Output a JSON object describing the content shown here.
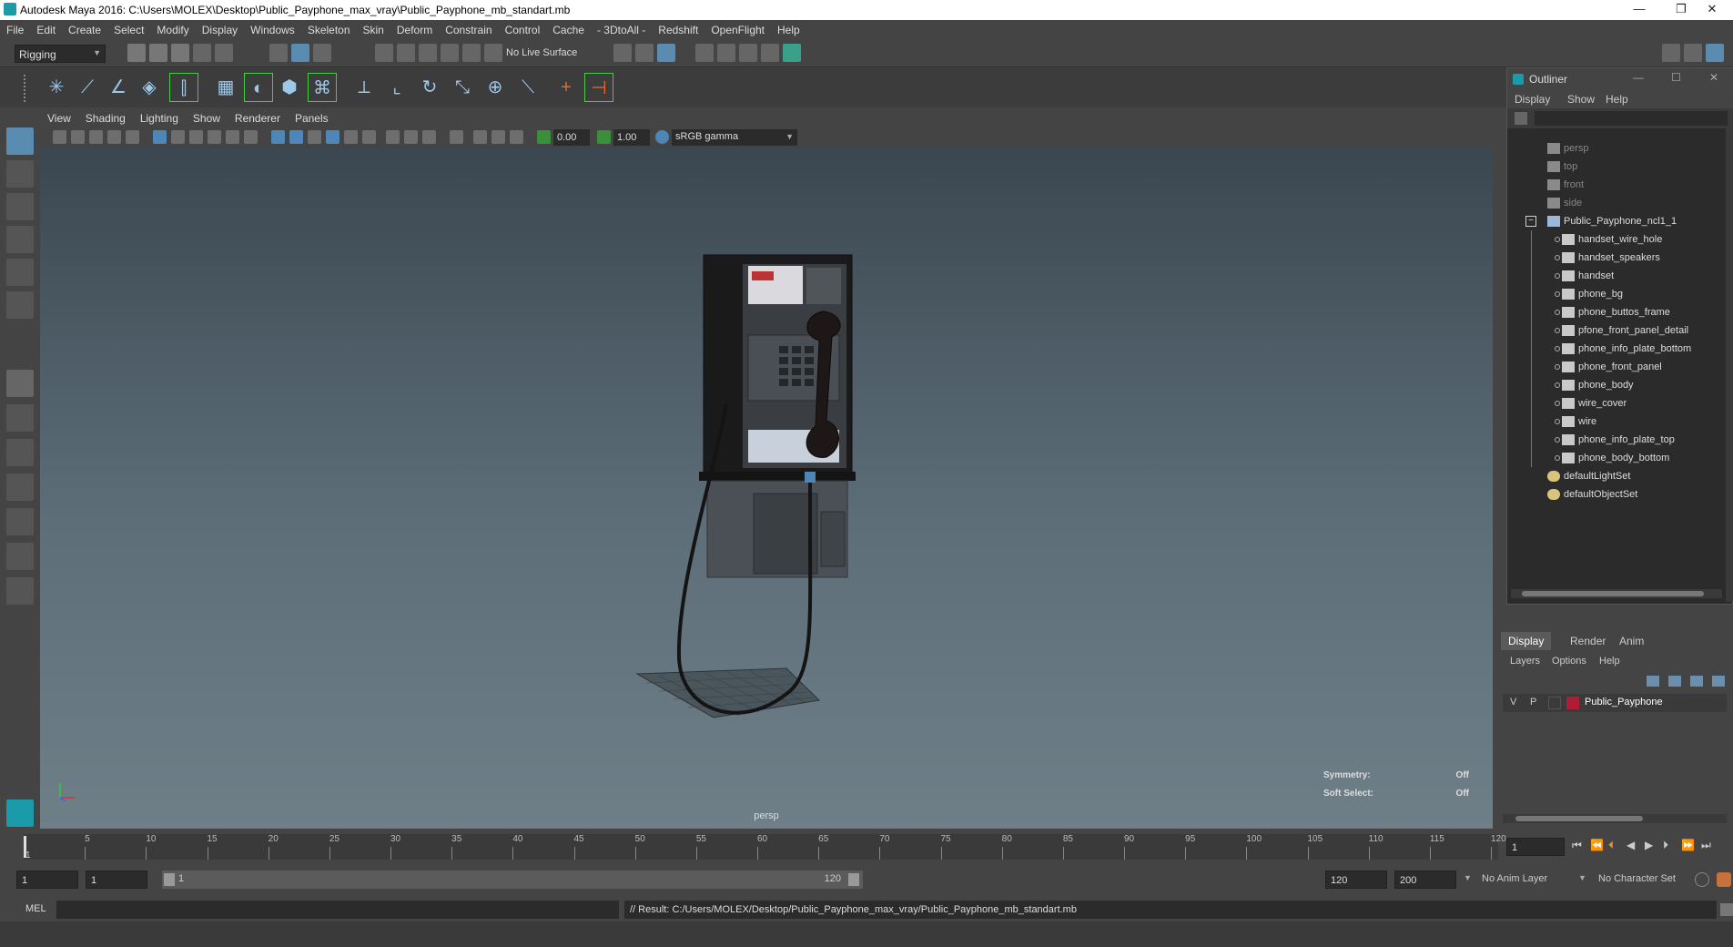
{
  "window": {
    "title": "Autodesk Maya 2016: C:\\Users\\MOLEX\\Desktop\\Public_Payphone_max_vray\\Public_Payphone_mb_standart.mb",
    "minimize": "—",
    "restore": "❐",
    "close": "✕"
  },
  "menubar": [
    "File",
    "Edit",
    "Create",
    "Select",
    "Modify",
    "Display",
    "Windows",
    "Skeleton",
    "Skin",
    "Deform",
    "Constrain",
    "Control",
    "Cache",
    "- 3DtoAll -",
    "Redshift",
    "OpenFlight",
    "Help"
  ],
  "status": {
    "menuset": "Rigging",
    "live_surface": "No Live Surface"
  },
  "viewport": {
    "menus": [
      "View",
      "Shading",
      "Lighting",
      "Show",
      "Renderer",
      "Panels"
    ],
    "exposure": "0.00",
    "gamma": "1.00",
    "colorspace": "sRGB gamma",
    "camera": "persp",
    "symmetry_label": "Symmetry:",
    "symmetry_value": "Off",
    "softselect_label": "Soft Select:",
    "softselect_value": "Off"
  },
  "outliner": {
    "title": "Outliner",
    "menus": [
      "Display",
      "Show",
      "Help"
    ],
    "items": [
      {
        "label": "persp",
        "type": "camera",
        "indent": 0
      },
      {
        "label": "top",
        "type": "camera",
        "indent": 0
      },
      {
        "label": "front",
        "type": "camera",
        "indent": 0
      },
      {
        "label": "side",
        "type": "camera",
        "indent": 0
      },
      {
        "label": "Public_Payphone_ncl1_1",
        "type": "group",
        "indent": 0
      },
      {
        "label": "handset_wire_hole",
        "type": "mesh",
        "indent": 1
      },
      {
        "label": "handset_speakers",
        "type": "mesh",
        "indent": 1
      },
      {
        "label": "handset",
        "type": "mesh",
        "indent": 1
      },
      {
        "label": "phone_bg",
        "type": "mesh",
        "indent": 1
      },
      {
        "label": "phone_buttos_frame",
        "type": "mesh",
        "indent": 1
      },
      {
        "label": "pfone_front_panel_detail",
        "type": "mesh",
        "indent": 1
      },
      {
        "label": "phone_info_plate_bottom",
        "type": "mesh",
        "indent": 1
      },
      {
        "label": "phone_front_panel",
        "type": "mesh",
        "indent": 1
      },
      {
        "label": "phone_body",
        "type": "mesh",
        "indent": 1
      },
      {
        "label": "wire_cover",
        "type": "mesh",
        "indent": 1
      },
      {
        "label": "wire",
        "type": "mesh",
        "indent": 1
      },
      {
        "label": "phone_info_plate_top",
        "type": "mesh",
        "indent": 1
      },
      {
        "label": "phone_body_bottom",
        "type": "mesh",
        "indent": 1
      },
      {
        "label": "defaultLightSet",
        "type": "set",
        "indent": 0
      },
      {
        "label": "defaultObjectSet",
        "type": "set",
        "indent": 0
      }
    ]
  },
  "layers": {
    "tabs": [
      "Display",
      "Render",
      "Anim"
    ],
    "menus": [
      "Layers",
      "Options",
      "Help"
    ],
    "layer": {
      "v": "V",
      "p": "P",
      "name": "Public_Payphone",
      "color": "#b01b35"
    }
  },
  "timeline": {
    "ticks": [
      "5",
      "10",
      "15",
      "20",
      "25",
      "30",
      "35",
      "40",
      "45",
      "50",
      "55",
      "60",
      "65",
      "70",
      "75",
      "80",
      "85",
      "90",
      "95",
      "100",
      "105",
      "110",
      "115",
      "120"
    ],
    "start_marker": "1",
    "current_frame": "1"
  },
  "range": {
    "start": "1",
    "playback_start": "1",
    "slider_start": "1",
    "slider_end": "120",
    "playback_end": "120",
    "end": "200",
    "anim_layer": "No Anim Layer",
    "char_set": "No Character Set"
  },
  "cmd": {
    "lang": "MEL",
    "result": "// Result: C:/Users/MOLEX/Desktop/Public_Payphone_max_vray/Public_Payphone_mb_standart.mb"
  },
  "colors": {
    "accent": "#5a8bb0",
    "viewport_top": "#3b4750",
    "viewport_bottom": "#6f7f88"
  }
}
